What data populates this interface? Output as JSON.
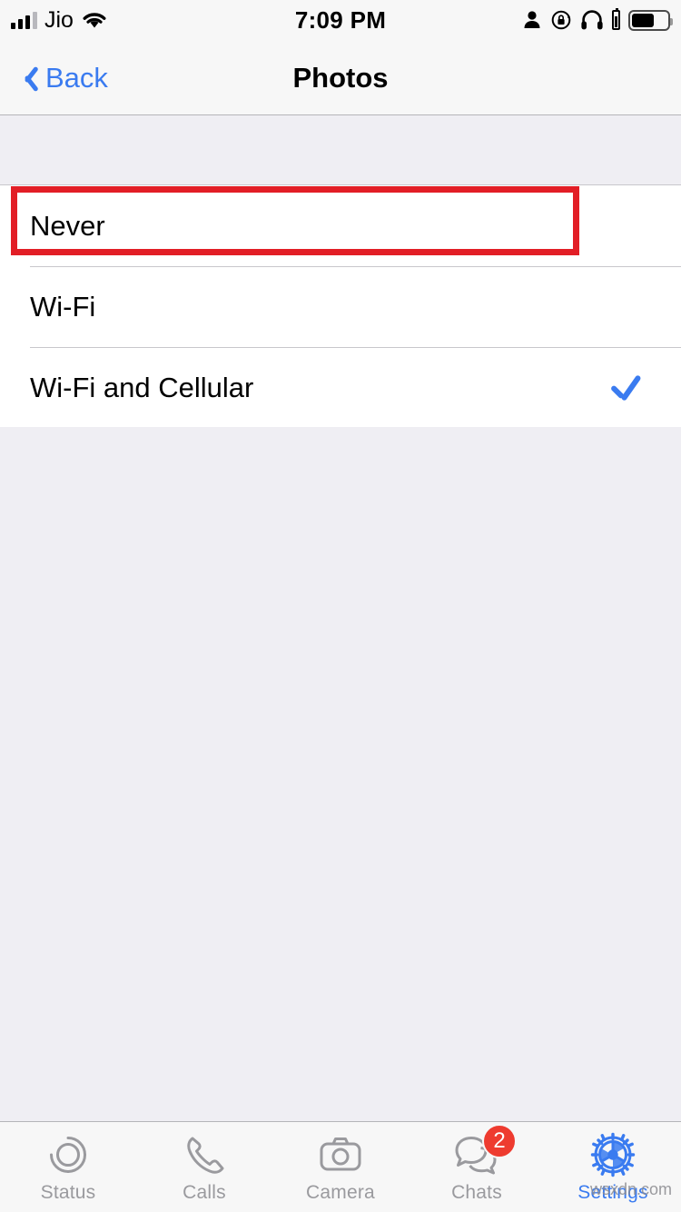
{
  "status_bar": {
    "carrier": "Jio",
    "time": "7:09 PM",
    "signal_icon": "signal-bars-icon",
    "wifi_icon": "wifi-icon",
    "person_icon": "person-icon",
    "rotation_lock_icon": "rotation-lock-icon",
    "headphones_icon": "headphones-icon",
    "battery_icon": "battery-icon"
  },
  "nav_bar": {
    "back_label": "Back",
    "back_icon": "chevron-left-icon",
    "title": "Photos"
  },
  "list": {
    "options": [
      {
        "label": "Never",
        "selected": false,
        "highlighted": true
      },
      {
        "label": "Wi-Fi",
        "selected": false,
        "highlighted": false
      },
      {
        "label": "Wi-Fi and Cellular",
        "selected": true,
        "highlighted": false
      }
    ],
    "checkmark_icon": "checkmark-icon"
  },
  "highlight": {
    "color": "#E21E26"
  },
  "tab_bar": {
    "tabs": [
      {
        "label": "Status",
        "icon": "status-rings-icon",
        "active": false,
        "badge": ""
      },
      {
        "label": "Calls",
        "icon": "phone-icon",
        "active": false,
        "badge": ""
      },
      {
        "label": "Camera",
        "icon": "camera-icon",
        "active": false,
        "badge": ""
      },
      {
        "label": "Chats",
        "icon": "chat-bubbles-icon",
        "active": false,
        "badge": "2"
      },
      {
        "label": "Settings",
        "icon": "gear-icon",
        "active": true,
        "badge": ""
      }
    ],
    "active_color": "#3A7BF0",
    "inactive_color": "#9A9A9E",
    "badge_color": "#EE3B2F"
  },
  "watermark": {
    "text": "wsxdn.com"
  }
}
